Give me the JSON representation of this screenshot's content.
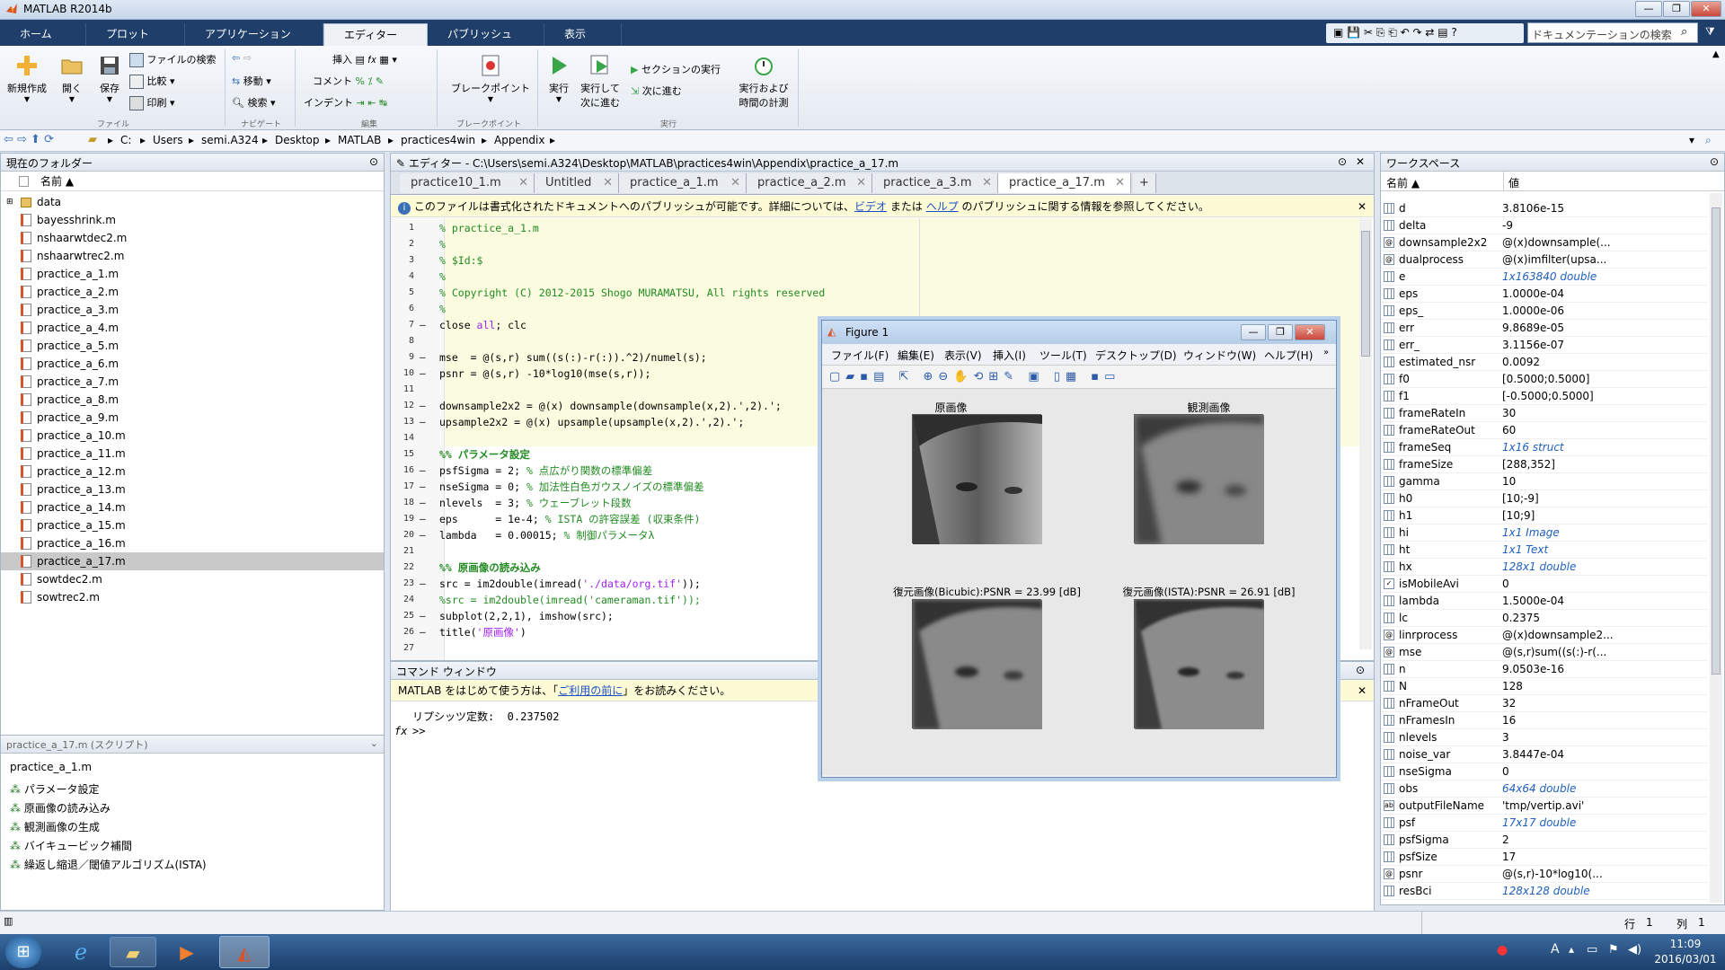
{
  "window": {
    "title": "MATLAB R2014b"
  },
  "ribbon_tabs": [
    "ホーム",
    "プロット",
    "アプリケーション",
    "エディター",
    "パブリッシュ",
    "表示"
  ],
  "active_tab": "エディター",
  "search": {
    "placeholder": "ドキュメンテーションの検索"
  },
  "ribbon": {
    "file": {
      "new": "新規作成",
      "open": "開く",
      "save": "保存",
      "find_files": "ファイルの検索",
      "compare": "比較",
      "print": "印刷",
      "group": "ファイル"
    },
    "navigate": {
      "go_to": "移動",
      "find": "検索",
      "group": "ナビゲート"
    },
    "edit": {
      "insert": "挿入",
      "comment": "コメント",
      "indent": "インデント",
      "group": "編集"
    },
    "breakpoints": {
      "label": "ブレークポイント",
      "group": "ブレークポイント"
    },
    "run": {
      "run": "実行",
      "run_advance": "実行して",
      "run_advance2": "次に進む",
      "run_section": "セクションの実行",
      "advance": "次に進む",
      "run_time": "実行および",
      "run_time2": "時間の計測",
      "group": "実行"
    }
  },
  "address": [
    "C:",
    "Users",
    "semi.A324",
    "Desktop",
    "MATLAB",
    "practices4win",
    "Appendix"
  ],
  "current_folder": {
    "title": "現在のフォルダー",
    "name_header": "名前 ▲",
    "items": [
      {
        "name": "data",
        "type": "folder"
      },
      {
        "name": "bayesshrink.m",
        "type": "file"
      },
      {
        "name": "nshaarwtdec2.m",
        "type": "file"
      },
      {
        "name": "nshaarwtrec2.m",
        "type": "file"
      },
      {
        "name": "practice_a_1.m",
        "type": "file"
      },
      {
        "name": "practice_a_2.m",
        "type": "file"
      },
      {
        "name": "practice_a_3.m",
        "type": "file"
      },
      {
        "name": "practice_a_4.m",
        "type": "file"
      },
      {
        "name": "practice_a_5.m",
        "type": "file"
      },
      {
        "name": "practice_a_6.m",
        "type": "file"
      },
      {
        "name": "practice_a_7.m",
        "type": "file"
      },
      {
        "name": "practice_a_8.m",
        "type": "file"
      },
      {
        "name": "practice_a_9.m",
        "type": "file"
      },
      {
        "name": "practice_a_10.m",
        "type": "file"
      },
      {
        "name": "practice_a_11.m",
        "type": "file"
      },
      {
        "name": "practice_a_12.m",
        "type": "file"
      },
      {
        "name": "practice_a_13.m",
        "type": "file"
      },
      {
        "name": "practice_a_14.m",
        "type": "file"
      },
      {
        "name": "practice_a_15.m",
        "type": "file"
      },
      {
        "name": "practice_a_16.m",
        "type": "file"
      },
      {
        "name": "practice_a_17.m",
        "type": "file",
        "selected": true
      },
      {
        "name": "sowtdec2.m",
        "type": "file"
      },
      {
        "name": "sowtrec2.m",
        "type": "file"
      }
    ]
  },
  "details": {
    "header": "practice_a_17.m (スクリプト)",
    "file_title": "practice_a_1.m",
    "sections": [
      "パラメータ設定",
      "原画像の読み込み",
      "観測画像の生成",
      "バイキュービック補間",
      "繰返し縮退／閾値アルゴリズム(ISTA)"
    ]
  },
  "editor": {
    "title": "エディター - C:\\Users\\semi.A324\\Desktop\\MATLAB\\practices4win\\Appendix\\practice_a_17.m",
    "tabs": [
      "practice10_1.m",
      "Untitled",
      "practice_a_1.m",
      "practice_a_2.m",
      "practice_a_3.m",
      "practice_a_17.m"
    ],
    "active_tab": "practice_a_17.m",
    "info": {
      "text1": "このファイルは書式化されたドキュメントへのパブリッシュが可能です。詳細については、",
      "link1": "ビデオ",
      "text2": " または ",
      "link2": "ヘルプ",
      "text3": " のパブリッシュに関する情報を参照してください。"
    },
    "lines": [
      {
        "n": "1",
        "d": "",
        "parts": [
          [
            "cm",
            "% practice_a_1.m"
          ]
        ]
      },
      {
        "n": "2",
        "d": "",
        "parts": [
          [
            "cm",
            "%"
          ]
        ]
      },
      {
        "n": "3",
        "d": "",
        "parts": [
          [
            "cm",
            "% $Id:$"
          ]
        ]
      },
      {
        "n": "4",
        "d": "",
        "parts": [
          [
            "cm",
            "%"
          ]
        ]
      },
      {
        "n": "5",
        "d": "",
        "parts": [
          [
            "cm",
            "% Copyright (C) 2012-2015 Shogo MURAMATSU, All rights reserved"
          ]
        ]
      },
      {
        "n": "6",
        "d": "",
        "parts": [
          [
            "cm",
            "%"
          ]
        ]
      },
      {
        "n": "7",
        "d": "—",
        "parts": [
          [
            "",
            "close "
          ],
          [
            "st",
            "all"
          ],
          [
            "",
            "; clc"
          ]
        ]
      },
      {
        "n": "8",
        "d": "",
        "parts": [
          [
            "",
            ""
          ]
        ]
      },
      {
        "n": "9",
        "d": "—",
        "parts": [
          [
            "",
            "mse  = @(s,r) sum((s(:)-r(:)).^2)/numel(s);"
          ]
        ]
      },
      {
        "n": "10",
        "d": "—",
        "parts": [
          [
            "",
            "psnr = @(s,r) -10*log10(mse(s,r));"
          ]
        ]
      },
      {
        "n": "11",
        "d": "",
        "parts": [
          [
            "",
            ""
          ]
        ]
      },
      {
        "n": "12",
        "d": "—",
        "parts": [
          [
            "",
            "downsample2x2 = @(x) downsample(downsample(x,2).',2).';"
          ]
        ]
      },
      {
        "n": "13",
        "d": "—",
        "parts": [
          [
            "",
            "upsample2x2 = @(x) upsample(upsample(x,2).',2).';"
          ]
        ]
      },
      {
        "n": "14",
        "d": "",
        "parts": [
          [
            "",
            ""
          ]
        ]
      },
      {
        "n": "15",
        "d": "",
        "parts": [
          [
            "cmb",
            "%% パラメータ設定"
          ]
        ]
      },
      {
        "n": "16",
        "d": "—",
        "parts": [
          [
            "",
            "psfSigma = 2; "
          ],
          [
            "cm",
            "% 点広がり関数の標準偏差"
          ]
        ]
      },
      {
        "n": "17",
        "d": "—",
        "parts": [
          [
            "",
            "nseSigma = 0; "
          ],
          [
            "cm",
            "% 加法性白色ガウスノイズの標準偏差"
          ]
        ]
      },
      {
        "n": "18",
        "d": "—",
        "parts": [
          [
            "",
            "nlevels  = 3; "
          ],
          [
            "cm",
            "% ウェーブレット段数"
          ]
        ]
      },
      {
        "n": "19",
        "d": "—",
        "parts": [
          [
            "",
            "eps      = 1e-4; "
          ],
          [
            "cm",
            "% ISTA の許容誤差 (収束条件)"
          ]
        ]
      },
      {
        "n": "20",
        "d": "—",
        "parts": [
          [
            "",
            "lambda   = 0.00015; "
          ],
          [
            "cm",
            "% 制御パラメータλ"
          ]
        ]
      },
      {
        "n": "21",
        "d": "",
        "parts": [
          [
            "",
            ""
          ]
        ]
      },
      {
        "n": "22",
        "d": "",
        "parts": [
          [
            "cmb",
            "%% 原画像の読み込み"
          ]
        ]
      },
      {
        "n": "23",
        "d": "—",
        "parts": [
          [
            "",
            "src = im2double(imread("
          ],
          [
            "st",
            "'./data/org.tif'"
          ],
          [
            "",
            "));"
          ]
        ]
      },
      {
        "n": "24",
        "d": "",
        "parts": [
          [
            "cm",
            "%src = im2double(imread('cameraman.tif'));"
          ]
        ]
      },
      {
        "n": "25",
        "d": "—",
        "parts": [
          [
            "",
            "subplot(2,2,1), imshow(src);"
          ]
        ]
      },
      {
        "n": "26",
        "d": "—",
        "parts": [
          [
            "",
            "title("
          ],
          [
            "st",
            "'原画像'"
          ],
          [
            "",
            ")"
          ]
        ]
      },
      {
        "n": "27",
        "d": "",
        "parts": [
          [
            "",
            ""
          ]
        ]
      }
    ]
  },
  "command_window": {
    "title": "コマンド ウィンドウ",
    "info_text1": "MATLAB をはじめて使う方は、「",
    "info_link": "ご利用の前に",
    "info_text2": "」をお読みください。",
    "output": "リプシッツ定数:  0.237502",
    "prompt": ">>",
    "fx": "fx"
  },
  "workspace": {
    "title": "ワークスペース",
    "col_name": "名前 ▲",
    "col_value": "値",
    "vars": [
      {
        "name": "d",
        "value": "3.8106e-15"
      },
      {
        "name": "delta",
        "value": "-9"
      },
      {
        "name": "downsample2x2",
        "value": "@(x)downsample(...",
        "icon": "fn"
      },
      {
        "name": "dualprocess",
        "value": "@(x)imfilter(upsa...",
        "icon": "fn"
      },
      {
        "name": "e",
        "value": "1x163840 double",
        "italic": true
      },
      {
        "name": "eps",
        "value": "1.0000e-04"
      },
      {
        "name": "eps_",
        "value": "1.0000e-06"
      },
      {
        "name": "err",
        "value": "9.8689e-05"
      },
      {
        "name": "err_",
        "value": "3.1156e-07"
      },
      {
        "name": "estimated_nsr",
        "value": "0.0092"
      },
      {
        "name": "f0",
        "value": "[0.5000;0.5000]"
      },
      {
        "name": "f1",
        "value": "[-0.5000;0.5000]"
      },
      {
        "name": "frameRateIn",
        "value": "30"
      },
      {
        "name": "frameRateOut",
        "value": "60"
      },
      {
        "name": "frameSeq",
        "value": "1x16 struct",
        "italic": true
      },
      {
        "name": "frameSize",
        "value": "[288,352]"
      },
      {
        "name": "gamma",
        "value": "10"
      },
      {
        "name": "h0",
        "value": "[10;-9]"
      },
      {
        "name": "h1",
        "value": "[10;9]"
      },
      {
        "name": "hi",
        "value": "1x1 Image",
        "italic": true
      },
      {
        "name": "ht",
        "value": "1x1 Text",
        "italic": true
      },
      {
        "name": "hx",
        "value": "128x1 double",
        "italic": true
      },
      {
        "name": "isMobileAvi",
        "value": "0",
        "icon": "check"
      },
      {
        "name": "lambda",
        "value": "1.5000e-04"
      },
      {
        "name": "lc",
        "value": "0.2375"
      },
      {
        "name": "linrprocess",
        "value": "@(x)downsample2...",
        "icon": "fn"
      },
      {
        "name": "mse",
        "value": "@(s,r)sum((s(:)-r(...",
        "icon": "fn"
      },
      {
        "name": "n",
        "value": "9.0503e-16"
      },
      {
        "name": "N",
        "value": "128"
      },
      {
        "name": "nFrameOut",
        "value": "32"
      },
      {
        "name": "nFramesIn",
        "value": "16"
      },
      {
        "name": "nlevels",
        "value": "3"
      },
      {
        "name": "noise_var",
        "value": "3.8447e-04"
      },
      {
        "name": "nseSigma",
        "value": "0"
      },
      {
        "name": "obs",
        "value": "64x64 double",
        "italic": true
      },
      {
        "name": "outputFileName",
        "value": "'tmp/vertip.avi'",
        "icon": "str"
      },
      {
        "name": "psf",
        "value": "17x17 double",
        "italic": true
      },
      {
        "name": "psfSigma",
        "value": "2"
      },
      {
        "name": "psfSize",
        "value": "17"
      },
      {
        "name": "psnr",
        "value": "@(s,r)-10*log10(...",
        "icon": "fn"
      },
      {
        "name": "resBci",
        "value": "128x128 double",
        "italic": true
      }
    ]
  },
  "figure": {
    "title": "Figure 1",
    "menu": [
      "ファイル(F)",
      "編集(E)",
      "表示(V)",
      "挿入(I)",
      "ツール(T)",
      "デスクトップ(D)",
      "ウィンドウ(W)",
      "ヘルプ(H)"
    ],
    "panels": [
      {
        "title": "原画像"
      },
      {
        "title": "観測画像"
      },
      {
        "title": "復元画像(Bicubic):PSNR = 23.99 [dB]"
      },
      {
        "title": "復元画像(ISTA):PSNR = 26.91 [dB]"
      }
    ]
  },
  "status": {
    "row_label": "行",
    "row": "1",
    "col_label": "列",
    "col": "1"
  },
  "taskbar": {
    "time": "11:09",
    "date": "2016/03/01",
    "ime": "A"
  }
}
